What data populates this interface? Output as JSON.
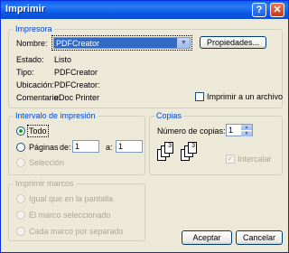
{
  "window": {
    "title": "Imprimir"
  },
  "printer": {
    "legend": "Impresora",
    "name_label": "Nombre:",
    "name_value": "PDFCreator",
    "properties_button": "Propiedades...",
    "status_label": "Estado:",
    "status_value": "Listo",
    "type_label": "Tipo:",
    "type_value": "PDFCreator",
    "location_label": "Ubicación:",
    "location_value": "PDFCreator:",
    "comment_label": "Comentario:",
    "comment_value": "eDoc Printer",
    "print_to_file": "Imprimir a un archivo"
  },
  "range": {
    "legend": "Intervalo de impresión",
    "all": "Todo",
    "pages": "Páginas",
    "from_label": "de:",
    "from_value": "1",
    "to_label": "a:",
    "to_value": "1",
    "selection": "Selección"
  },
  "copies": {
    "legend": "Copias",
    "count_label": "Número de copias:",
    "count_value": "1",
    "collate": "Intercalar"
  },
  "frames": {
    "legend": "Imprimir marcos",
    "as_screen": "Igual que en la pantalla",
    "selected": "El marco seleccionado",
    "each_separate": "Cada marco por separado"
  },
  "buttons": {
    "ok": "Aceptar",
    "cancel": "Cancelar"
  }
}
